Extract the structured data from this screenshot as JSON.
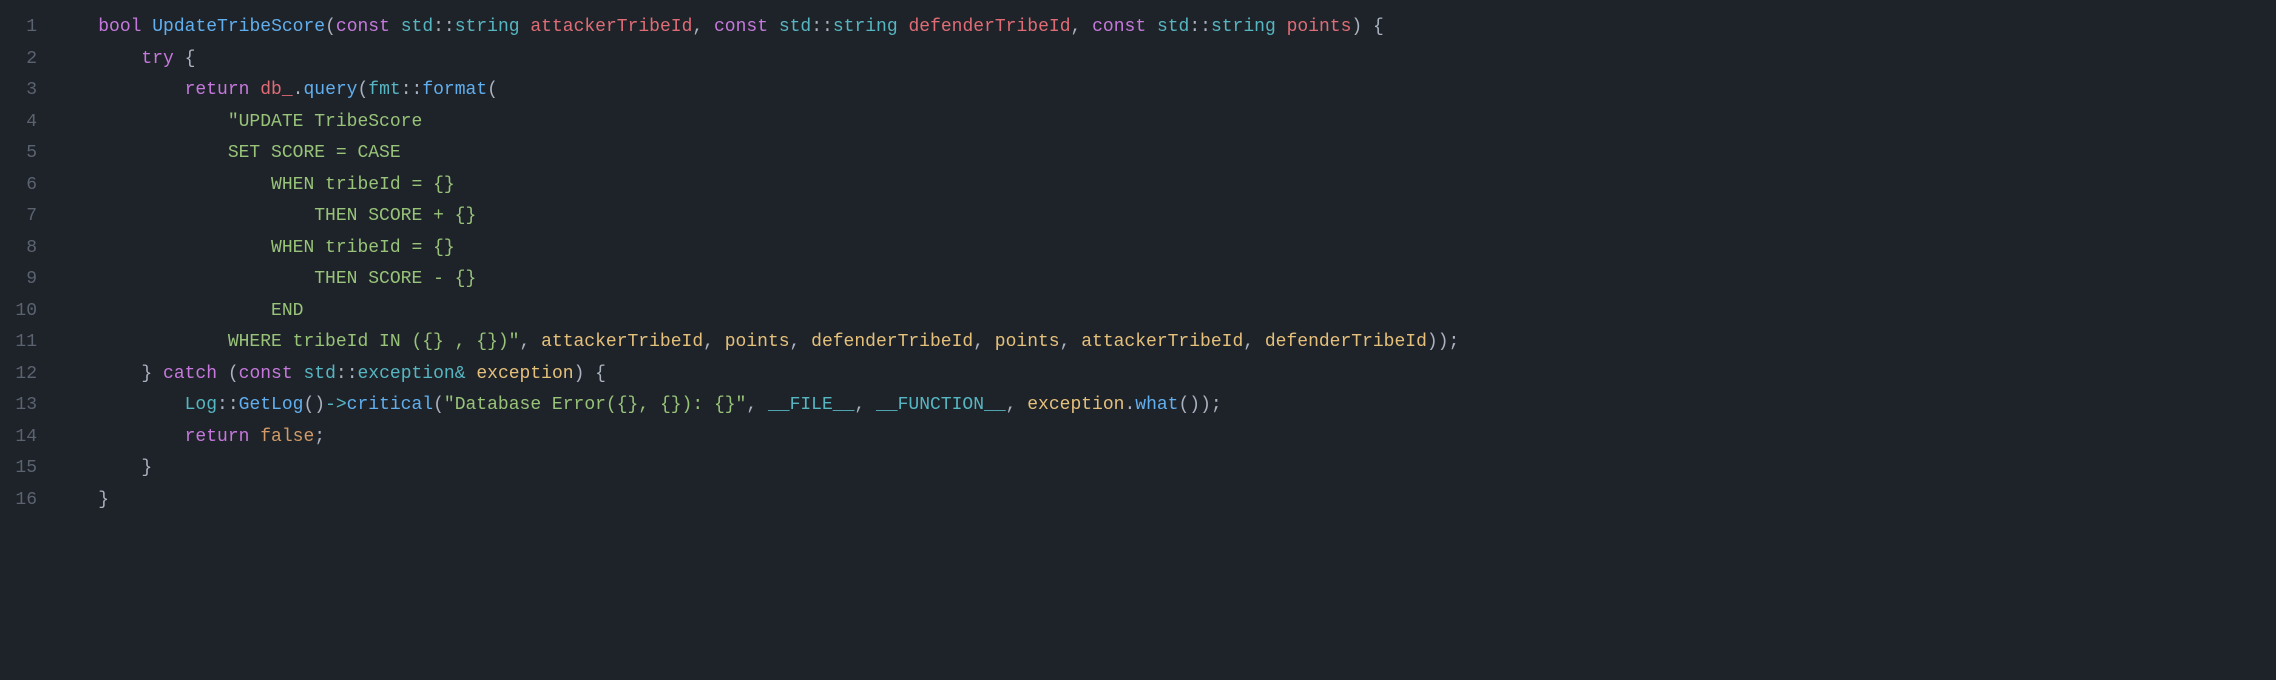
{
  "lines": [
    {
      "num": "1",
      "indent": "    ",
      "tokens": [
        {
          "t": "bool",
          "c": "tk-type"
        },
        {
          "t": " "
        },
        {
          "t": "UpdateTribeScore",
          "c": "tk-func-name"
        },
        {
          "t": "(",
          "c": "tk-punct"
        },
        {
          "t": "const",
          "c": "tk-keyword"
        },
        {
          "t": " "
        },
        {
          "t": "std",
          "c": "tk-namespace"
        },
        {
          "t": "::",
          "c": "tk-punct"
        },
        {
          "t": "string",
          "c": "tk-namespace"
        },
        {
          "t": " "
        },
        {
          "t": "attackerTribeId",
          "c": "tk-param"
        },
        {
          "t": ", ",
          "c": "tk-punct"
        },
        {
          "t": "const",
          "c": "tk-keyword"
        },
        {
          "t": " "
        },
        {
          "t": "std",
          "c": "tk-namespace"
        },
        {
          "t": "::",
          "c": "tk-punct"
        },
        {
          "t": "string",
          "c": "tk-namespace"
        },
        {
          "t": " "
        },
        {
          "t": "defenderTribeId",
          "c": "tk-param"
        },
        {
          "t": ", ",
          "c": "tk-punct"
        },
        {
          "t": "const",
          "c": "tk-keyword"
        },
        {
          "t": " "
        },
        {
          "t": "std",
          "c": "tk-namespace"
        },
        {
          "t": "::",
          "c": "tk-punct"
        },
        {
          "t": "string",
          "c": "tk-namespace"
        },
        {
          "t": " "
        },
        {
          "t": "points",
          "c": "tk-param"
        },
        {
          "t": ") {",
          "c": "tk-punct"
        }
      ]
    },
    {
      "num": "2",
      "indent": "        ",
      "tokens": [
        {
          "t": "try",
          "c": "tk-keyword"
        },
        {
          "t": " {",
          "c": "tk-punct"
        }
      ]
    },
    {
      "num": "3",
      "indent": "            ",
      "tokens": [
        {
          "t": "return",
          "c": "tk-keyword"
        },
        {
          "t": " "
        },
        {
          "t": "db_",
          "c": "tk-member"
        },
        {
          "t": ".",
          "c": "tk-punct"
        },
        {
          "t": "query",
          "c": "tk-method"
        },
        {
          "t": "(",
          "c": "tk-punct"
        },
        {
          "t": "fmt",
          "c": "tk-namespace"
        },
        {
          "t": "::",
          "c": "tk-punct"
        },
        {
          "t": "format",
          "c": "tk-method"
        },
        {
          "t": "(",
          "c": "tk-punct"
        }
      ]
    },
    {
      "num": "4",
      "indent": "                ",
      "tokens": [
        {
          "t": "\"UPDATE TribeScore ",
          "c": "tk-string"
        }
      ]
    },
    {
      "num": "5",
      "indent": "                ",
      "tokens": [
        {
          "t": "SET SCORE = CASE ",
          "c": "tk-string"
        }
      ]
    },
    {
      "num": "6",
      "indent": "                    ",
      "tokens": [
        {
          "t": "WHEN tribeId = {} ",
          "c": "tk-string"
        }
      ]
    },
    {
      "num": "7",
      "indent": "                        ",
      "tokens": [
        {
          "t": "THEN SCORE + {} ",
          "c": "tk-string"
        }
      ]
    },
    {
      "num": "8",
      "indent": "                    ",
      "tokens": [
        {
          "t": "WHEN tribeId = {} ",
          "c": "tk-string"
        }
      ]
    },
    {
      "num": "9",
      "indent": "                        ",
      "tokens": [
        {
          "t": "THEN SCORE - {} ",
          "c": "tk-string"
        }
      ]
    },
    {
      "num": "10",
      "indent": "                    ",
      "tokens": [
        {
          "t": "END ",
          "c": "tk-string"
        }
      ]
    },
    {
      "num": "11",
      "indent": "                ",
      "tokens": [
        {
          "t": "WHERE tribeId IN ({} , {})\"",
          "c": "tk-string"
        },
        {
          "t": ", ",
          "c": "tk-punct"
        },
        {
          "t": "attackerTribeId",
          "c": "tk-var"
        },
        {
          "t": ", ",
          "c": "tk-punct"
        },
        {
          "t": "points",
          "c": "tk-var"
        },
        {
          "t": ", ",
          "c": "tk-punct"
        },
        {
          "t": "defenderTribeId",
          "c": "tk-var"
        },
        {
          "t": ", ",
          "c": "tk-punct"
        },
        {
          "t": "points",
          "c": "tk-var"
        },
        {
          "t": ", ",
          "c": "tk-punct"
        },
        {
          "t": "attackerTribeId",
          "c": "tk-var"
        },
        {
          "t": ", ",
          "c": "tk-punct"
        },
        {
          "t": "defenderTribeId",
          "c": "tk-var"
        },
        {
          "t": "));",
          "c": "tk-punct"
        }
      ]
    },
    {
      "num": "12",
      "indent": "        ",
      "tokens": [
        {
          "t": "} ",
          "c": "tk-punct"
        },
        {
          "t": "catch",
          "c": "tk-keyword"
        },
        {
          "t": " (",
          "c": "tk-punct"
        },
        {
          "t": "const",
          "c": "tk-keyword"
        },
        {
          "t": " "
        },
        {
          "t": "std",
          "c": "tk-namespace"
        },
        {
          "t": "::",
          "c": "tk-punct"
        },
        {
          "t": "exception",
          "c": "tk-namespace"
        },
        {
          "t": "&",
          "c": "tk-operator"
        },
        {
          "t": " "
        },
        {
          "t": "exception",
          "c": "tk-var"
        },
        {
          "t": ") {",
          "c": "tk-punct"
        }
      ]
    },
    {
      "num": "13",
      "indent": "            ",
      "tokens": [
        {
          "t": "Log",
          "c": "tk-namespace"
        },
        {
          "t": "::",
          "c": "tk-punct"
        },
        {
          "t": "GetLog",
          "c": "tk-method"
        },
        {
          "t": "()",
          "c": "tk-punct"
        },
        {
          "t": "->",
          "c": "tk-operator"
        },
        {
          "t": "critical",
          "c": "tk-method"
        },
        {
          "t": "(",
          "c": "tk-punct"
        },
        {
          "t": "\"Database Error({}, {}): {}\"",
          "c": "tk-string"
        },
        {
          "t": ", ",
          "c": "tk-punct"
        },
        {
          "t": "__FILE__",
          "c": "tk-macro"
        },
        {
          "t": ", ",
          "c": "tk-punct"
        },
        {
          "t": "__FUNCTION__",
          "c": "tk-macro"
        },
        {
          "t": ", ",
          "c": "tk-punct"
        },
        {
          "t": "exception",
          "c": "tk-var"
        },
        {
          "t": ".",
          "c": "tk-punct"
        },
        {
          "t": "what",
          "c": "tk-method"
        },
        {
          "t": "());",
          "c": "tk-punct"
        }
      ]
    },
    {
      "num": "14",
      "indent": "            ",
      "tokens": [
        {
          "t": "return",
          "c": "tk-keyword"
        },
        {
          "t": " "
        },
        {
          "t": "false",
          "c": "tk-bool"
        },
        {
          "t": ";",
          "c": "tk-punct"
        }
      ]
    },
    {
      "num": "15",
      "indent": "        ",
      "tokens": [
        {
          "t": "}",
          "c": "tk-punct"
        }
      ]
    },
    {
      "num": "16",
      "indent": "    ",
      "tokens": [
        {
          "t": "}",
          "c": "tk-punct"
        }
      ]
    }
  ]
}
